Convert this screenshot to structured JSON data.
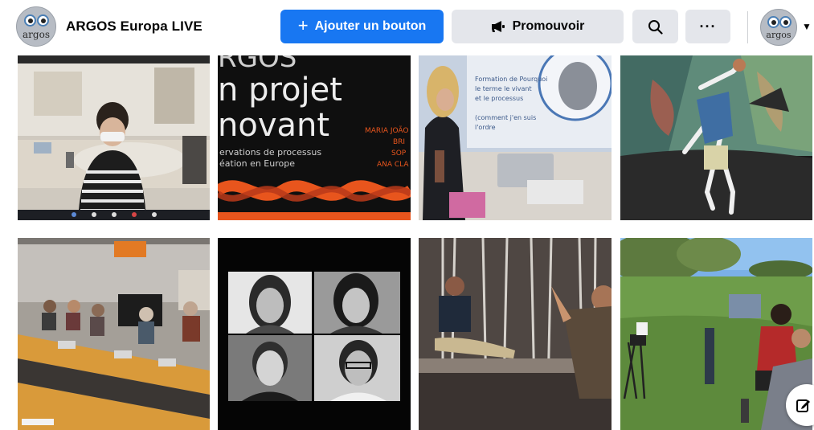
{
  "header": {
    "page_name": "ARGOS Europa LIVE",
    "avatar_text": "argos",
    "add_button_label": "Ajouter un bouton",
    "promote_button_label": "Promouvoir",
    "more_label": "···"
  },
  "tiles": [
    {
      "name": "photo-video-meeting"
    },
    {
      "name": "photo-project-cover",
      "lines": [
        "RGOS",
        "n projet",
        "novant"
      ],
      "subtitle": [
        "ervations de processus",
        "éation en Europe"
      ],
      "names": [
        "MARIA JOÃO",
        "BRI",
        "SOP",
        "ANA CLA"
      ]
    },
    {
      "name": "photo-presentation",
      "slide_lines": [
        "Formation de Pourquoi",
        "le terme le vivant",
        "et le processus",
        "(comment j'en suis",
        "l'ordre"
      ]
    },
    {
      "name": "photo-dance-performance"
    },
    {
      "name": "photo-conference-room"
    },
    {
      "name": "photo-portrait-collage"
    },
    {
      "name": "photo-rehearsal-stage"
    },
    {
      "name": "photo-outdoor-filming"
    }
  ],
  "colors": {
    "primary": "#1877f2",
    "grey_button": "#e4e6eb",
    "orange_accent": "#e8551d"
  }
}
